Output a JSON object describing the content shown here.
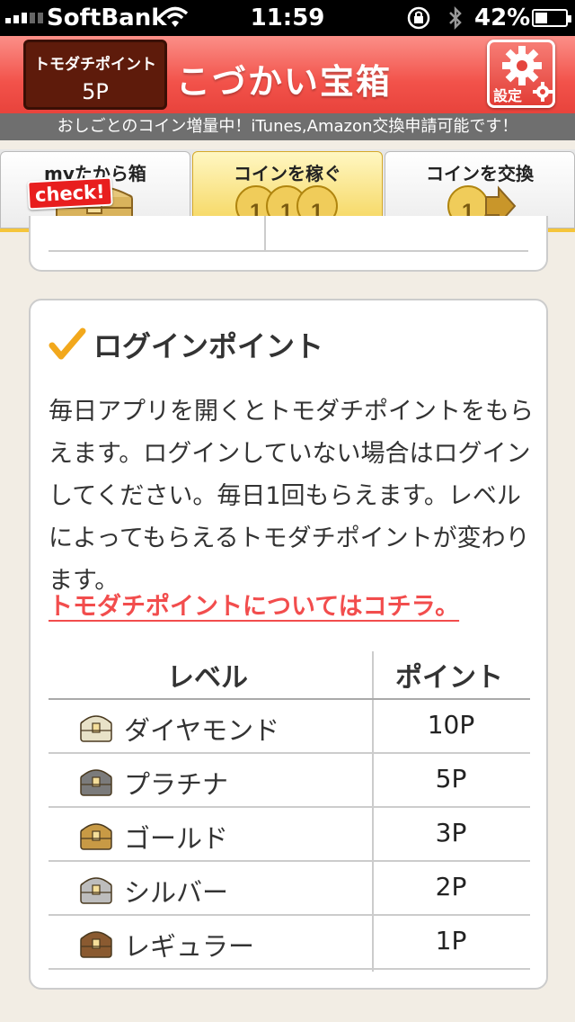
{
  "status_bar": {
    "carrier": "SoftBank",
    "time": "11:59",
    "battery": "42%",
    "battery_level": 0.42
  },
  "header": {
    "points_label": "トモダチポイント",
    "points_value": "5P",
    "app_title": "こづかい宝箱",
    "settings_label": "設定"
  },
  "banner": {
    "text": "おしごとのコイン増量中！iTunes,Amazon交換申請可能です！"
  },
  "tabs": [
    {
      "label": "myたから箱",
      "badge": "check!"
    },
    {
      "label": "コインを稼ぐ",
      "active": true
    },
    {
      "label": "コインを交換"
    }
  ],
  "login_card": {
    "title": "ログインポイント",
    "description": "毎日アプリを開くとトモダチポイントをもらえます。ログインしていない場合はログインしてください。毎日1回もらえます。レベルによってもらえるトモダチポイントが変わります。",
    "link": "トモダチポイントについてはコチラ。",
    "table": {
      "headers": {
        "level": "レベル",
        "point": "ポイント"
      },
      "rows": [
        {
          "level": "ダイヤモンド",
          "point": "10P",
          "chest_color": "#e8e2c8"
        },
        {
          "level": "プラチナ",
          "point": "5P",
          "chest_color": "#7b7b7b"
        },
        {
          "level": "ゴールド",
          "point": "3P",
          "chest_color": "#c89a45"
        },
        {
          "level": "シルバー",
          "point": "2P",
          "chest_color": "#bdbdbd"
        },
        {
          "level": "レギュラー",
          "point": "1P",
          "chest_color": "#8a5a30"
        }
      ]
    }
  },
  "colors": {
    "header_red": "#f2524a",
    "tab_active": "#f5d55b",
    "link_red": "#f24d4d",
    "points_box": "#5e1b0b"
  }
}
